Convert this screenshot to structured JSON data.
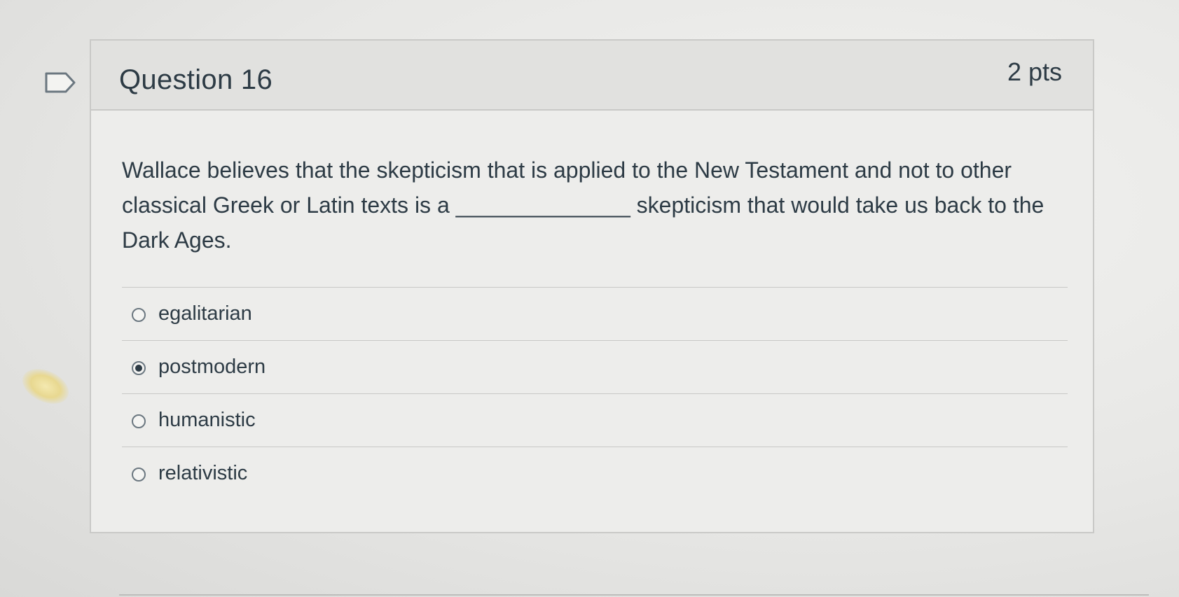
{
  "question": {
    "title": "Question 16",
    "points": "2 pts",
    "text": "Wallace believes that the skepticism that is applied to the New Testament and not to other classical Greek or Latin texts is a ______________ skepticism that would take us back to the Dark Ages."
  },
  "answers": [
    {
      "label": "egalitarian",
      "selected": false
    },
    {
      "label": "postmodern",
      "selected": true
    },
    {
      "label": "humanistic",
      "selected": false
    },
    {
      "label": "relativistic",
      "selected": false
    }
  ],
  "icons": {
    "flag": "flag-question-icon",
    "radio": "radio-button-icon"
  },
  "colors": {
    "text": "#2d3b45",
    "card_background": "#ededeb",
    "header_background": "#e1e1df",
    "border": "#c9c9c7"
  }
}
